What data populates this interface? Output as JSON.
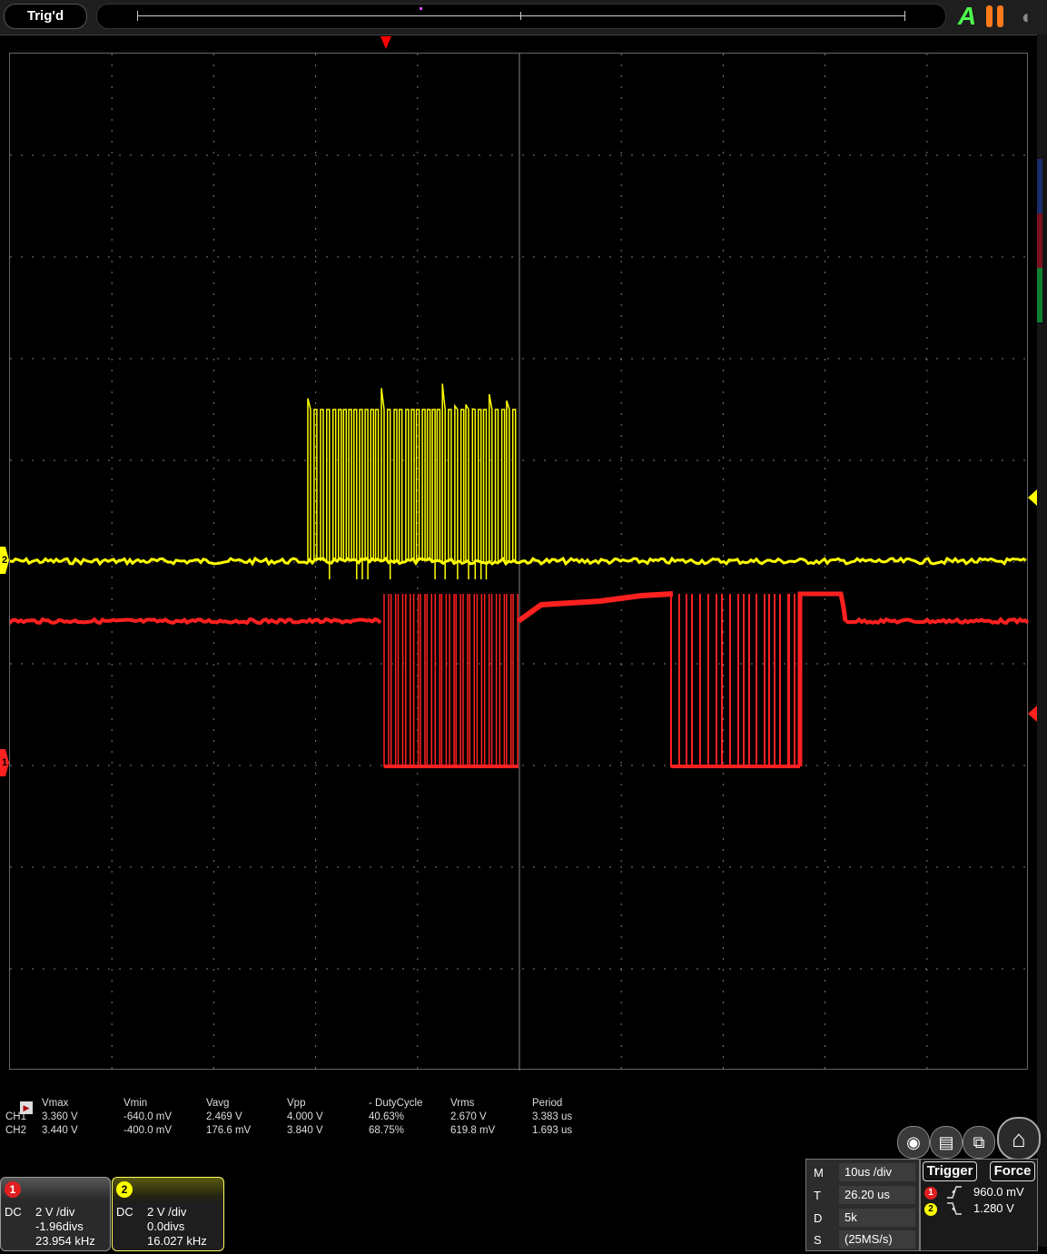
{
  "top_bar": {
    "trigger_status": "Trig'd",
    "auto_label": "A"
  },
  "colors": {
    "ch1": "#ff2020",
    "ch2": "#ffff00",
    "grid": "#8a8a8a",
    "background": "#000000"
  },
  "channel_markers": {
    "ch1": "1",
    "ch2": "2"
  },
  "measurements": {
    "headers": [
      "",
      "Vmax",
      "Vmin",
      "Vavg",
      "Vpp",
      "- DutyCycle",
      "Vrms",
      "Period"
    ],
    "rows": [
      [
        "CH1",
        "3.360 V",
        "-640.0 mV",
        "2.469 V",
        "4.000 V",
        "40.63%",
        "2.670 V",
        "3.383 us"
      ],
      [
        "CH2",
        "3.440 V",
        "-400.0 mV",
        "176.6 mV",
        "3.840 V",
        "68.75%",
        "619.8 mV",
        "1.693 us"
      ]
    ]
  },
  "channels": [
    {
      "number": "1",
      "coupling": "DC",
      "scale": "2 V /div",
      "offset": "-1.96divs",
      "frequency": "23.954 kHz"
    },
    {
      "number": "2",
      "coupling": "DC",
      "scale": "2 V /div",
      "offset": "0.0divs",
      "frequency": "16.027 kHz"
    }
  ],
  "timebase": [
    {
      "key": "M",
      "value": "10us /div"
    },
    {
      "key": "T",
      "value": "26.20 us"
    },
    {
      "key": "D",
      "value": "5k"
    },
    {
      "key": "S",
      "value": "(25MS/s)"
    }
  ],
  "trigger_panel": {
    "trigger_label": "Trigger",
    "force_label": "Force",
    "sources": [
      {
        "channel": "1",
        "edge": "rising",
        "level": "960.0 mV"
      },
      {
        "channel": "2",
        "edge": "falling",
        "level": "1.280 V"
      }
    ]
  },
  "icons": [
    "camera-icon",
    "save-icon",
    "windows-icon",
    "home-icon",
    "pause-icon",
    "play-icon"
  ]
}
